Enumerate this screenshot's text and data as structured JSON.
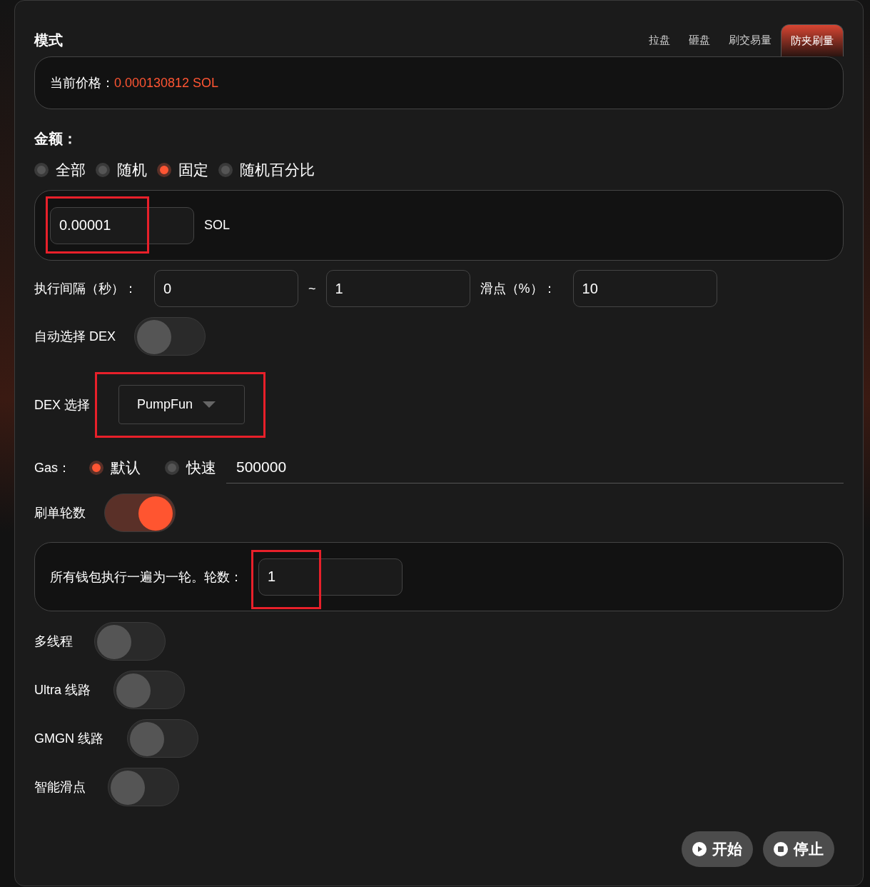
{
  "mode": {
    "title": "模式",
    "tabs": [
      {
        "label": "拉盘",
        "selected": false
      },
      {
        "label": "砸盘",
        "selected": false
      },
      {
        "label": "刷交易量",
        "selected": false
      },
      {
        "label": "防夹刷量",
        "selected": true
      }
    ]
  },
  "price": {
    "label": "当前价格：",
    "value": "0.000130812 SOL"
  },
  "amount": {
    "title": "金额：",
    "options": [
      {
        "label": "全部",
        "selected": false
      },
      {
        "label": "随机",
        "selected": false
      },
      {
        "label": "固定",
        "selected": true
      },
      {
        "label": "随机百分比",
        "selected": false
      }
    ],
    "value": "0.00001",
    "unit": "SOL",
    "highlighted": true
  },
  "interval": {
    "label": "执行间隔（秒）：",
    "min": "0",
    "separator": "~",
    "max": "1",
    "slippage_label": "滑点（%）：",
    "slippage": "10"
  },
  "auto_dex": {
    "label": "自动选择 DEX",
    "on": false
  },
  "dex": {
    "label": "DEX 选择",
    "value": "PumpFun",
    "highlighted": true
  },
  "gas": {
    "label": "Gas：",
    "options": [
      {
        "label": "默认",
        "selected": true
      },
      {
        "label": "快速",
        "selected": false
      }
    ],
    "value": "500000"
  },
  "rounds": {
    "label": "刷单轮数",
    "on": true,
    "hint": "所有钱包执行一遍为一轮。轮数：",
    "value": "1",
    "highlighted": true
  },
  "toggles": [
    {
      "label": "多线程",
      "on": false
    },
    {
      "label": "Ultra 线路",
      "on": false
    },
    {
      "label": "GMGN 线路",
      "on": false
    },
    {
      "label": "智能滑点",
      "on": false
    }
  ],
  "buttons": [
    {
      "label": "开始",
      "kind": "play"
    },
    {
      "label": "停止",
      "kind": "stop"
    }
  ]
}
